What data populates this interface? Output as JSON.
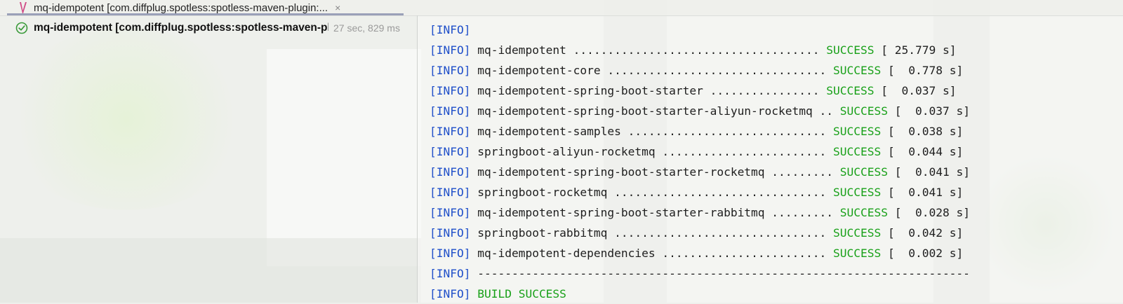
{
  "tab": {
    "title": "mq-idempotent [com.diffplug.spotless:spotless-maven-plugin:...",
    "close": "×",
    "icon": "maven-icon"
  },
  "run_tree": {
    "status_icon": "check-circle-icon",
    "label": "mq-idempotent [com.diffplug.spotless:spotless-maven-plugin:apply]",
    "time": "27 sec, 829 ms"
  },
  "console": {
    "level": "[INFO]",
    "rows": [
      {
        "module": "",
        "dots": "",
        "status": "",
        "time": ""
      },
      {
        "module": "mq-idempotent ",
        "dots": "....................................",
        "status": "SUCCESS",
        "time": "[ 25.779 s]"
      },
      {
        "module": "mq-idempotent-core ",
        "dots": "................................",
        "status": "SUCCESS",
        "time": "[  0.778 s]"
      },
      {
        "module": "mq-idempotent-spring-boot-starter ",
        "dots": "................",
        "status": "SUCCESS",
        "time": "[  0.037 s]"
      },
      {
        "module": "mq-idempotent-spring-boot-starter-aliyun-rocketmq ",
        "dots": "..",
        "status": "SUCCESS",
        "time": "[  0.037 s]"
      },
      {
        "module": "mq-idempotent-samples ",
        "dots": ".............................",
        "status": "SUCCESS",
        "time": "[  0.038 s]"
      },
      {
        "module": "springboot-aliyun-rocketmq ",
        "dots": "........................",
        "status": "SUCCESS",
        "time": "[  0.044 s]"
      },
      {
        "module": "mq-idempotent-spring-boot-starter-rocketmq ",
        "dots": ".........",
        "status": "SUCCESS",
        "time": "[  0.041 s]"
      },
      {
        "module": "springboot-rocketmq ",
        "dots": "...............................",
        "status": "SUCCESS",
        "time": "[  0.041 s]"
      },
      {
        "module": "mq-idempotent-spring-boot-starter-rabbitmq ",
        "dots": ".........",
        "status": "SUCCESS",
        "time": "[  0.028 s]"
      },
      {
        "module": "springboot-rabbitmq ",
        "dots": "...............................",
        "status": "SUCCESS",
        "time": "[  0.042 s]"
      },
      {
        "module": "mq-idempotent-dependencies ",
        "dots": "........................",
        "status": "SUCCESS",
        "time": "[  0.002 s]"
      }
    ],
    "separator": "------------------------------------------------------------------------",
    "build_result": "BUILD SUCCESS"
  }
}
